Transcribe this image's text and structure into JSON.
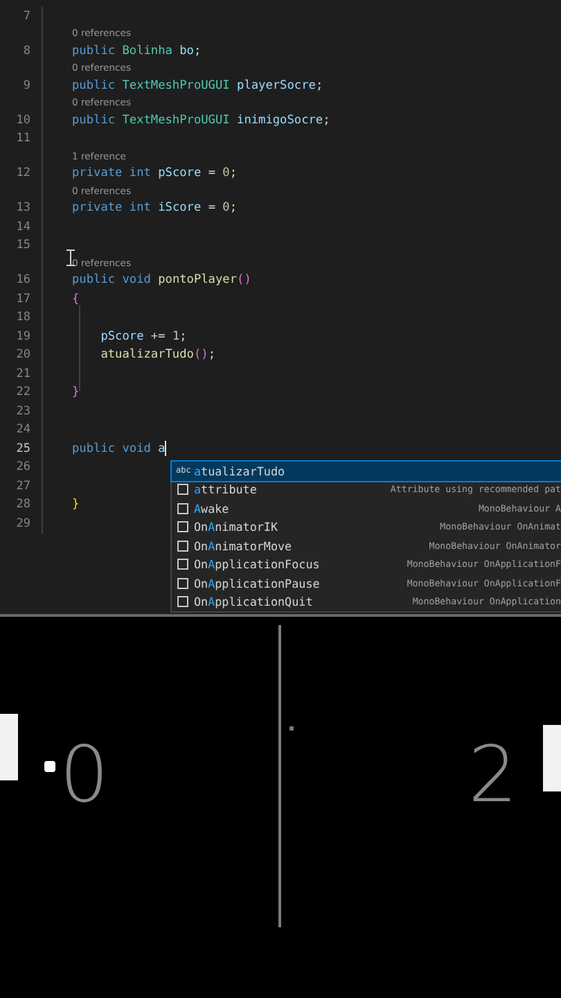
{
  "editor": {
    "lines": [
      {
        "kind": "code",
        "number": "7",
        "current": false
      },
      {
        "kind": "codelens",
        "text": "0 references"
      },
      {
        "kind": "code",
        "number": "8",
        "current": false,
        "tokens": [
          {
            "kind": "keyword",
            "text": "public "
          },
          {
            "kind": "type",
            "text": "Bolinha "
          },
          {
            "kind": "ident",
            "text": "bo"
          },
          {
            "kind": "punct",
            "text": ";"
          }
        ]
      },
      {
        "kind": "codelens",
        "text": "0 references"
      },
      {
        "kind": "code",
        "number": "9",
        "current": false,
        "tokens": [
          {
            "kind": "keyword",
            "text": "public "
          },
          {
            "kind": "type",
            "text": "TextMeshProUGUI "
          },
          {
            "kind": "ident",
            "text": "playerSocre"
          },
          {
            "kind": "punct",
            "text": ";"
          }
        ]
      },
      {
        "kind": "codelens",
        "text": "0 references"
      },
      {
        "kind": "code",
        "number": "10",
        "current": false,
        "tokens": [
          {
            "kind": "keyword",
            "text": "public "
          },
          {
            "kind": "type",
            "text": "TextMeshProUGUI "
          },
          {
            "kind": "ident",
            "text": "inimigoSocre"
          },
          {
            "kind": "punct",
            "text": ";"
          }
        ]
      },
      {
        "kind": "code",
        "number": "11",
        "current": false
      },
      {
        "kind": "codelens",
        "text": "1 reference"
      },
      {
        "kind": "code",
        "number": "12",
        "current": false,
        "tokens": [
          {
            "kind": "keyword",
            "text": "private int "
          },
          {
            "kind": "ident",
            "text": "pScore "
          },
          {
            "kind": "punct",
            "text": "= "
          },
          {
            "kind": "number",
            "text": "0"
          },
          {
            "kind": "punct",
            "text": ";"
          }
        ]
      },
      {
        "kind": "codelens",
        "text": "0 references"
      },
      {
        "kind": "code",
        "number": "13",
        "current": false,
        "tokens": [
          {
            "kind": "keyword",
            "text": "private int "
          },
          {
            "kind": "ident",
            "text": "iScore "
          },
          {
            "kind": "punct",
            "text": "= "
          },
          {
            "kind": "number",
            "text": "0"
          },
          {
            "kind": "punct",
            "text": ";"
          }
        ]
      },
      {
        "kind": "code",
        "number": "14",
        "current": false
      },
      {
        "kind": "code",
        "number": "15",
        "current": false
      },
      {
        "kind": "codelens",
        "text": "0 references"
      },
      {
        "kind": "code",
        "number": "16",
        "current": false,
        "tokens": [
          {
            "kind": "keyword",
            "text": "public void "
          },
          {
            "kind": "method",
            "text": "pontoPlayer"
          },
          {
            "kind": "paren",
            "text": "()"
          }
        ]
      },
      {
        "kind": "code",
        "number": "17",
        "current": false,
        "tokens": [
          {
            "kind": "brace",
            "text": "{"
          }
        ]
      },
      {
        "kind": "code",
        "number": "18",
        "current": false
      },
      {
        "kind": "code",
        "number": "19",
        "current": false,
        "tokens": [
          {
            "kind": "ident",
            "text": "    pScore "
          },
          {
            "kind": "punct",
            "text": "+= "
          },
          {
            "kind": "number",
            "text": "1"
          },
          {
            "kind": "punct",
            "text": ";"
          }
        ]
      },
      {
        "kind": "code",
        "number": "20",
        "current": false,
        "tokens": [
          {
            "kind": "method",
            "text": "    atualizarTudo"
          },
          {
            "kind": "paren",
            "text": "()"
          },
          {
            "kind": "punct",
            "text": ";"
          }
        ]
      },
      {
        "kind": "code",
        "number": "21",
        "current": false
      },
      {
        "kind": "code",
        "number": "22",
        "current": false,
        "tokens": [
          {
            "kind": "brace",
            "text": "}"
          }
        ]
      },
      {
        "kind": "code",
        "number": "23",
        "current": false
      },
      {
        "kind": "code",
        "number": "24",
        "current": false
      },
      {
        "kind": "code",
        "number": "25",
        "current": true,
        "tokens": [
          {
            "kind": "keyword",
            "text": "public void "
          },
          {
            "kind": "ident",
            "text": "a"
          }
        ]
      },
      {
        "kind": "code",
        "number": "26",
        "current": false
      },
      {
        "kind": "code",
        "number": "27",
        "current": false
      },
      {
        "kind": "code",
        "number": "28",
        "current": false,
        "tokens": [
          {
            "kind": "outerbrace",
            "text": "}"
          }
        ]
      },
      {
        "kind": "code",
        "number": "29",
        "current": false
      }
    ],
    "suggestions": [
      {
        "kind": "text",
        "icon_text": "abc",
        "selected": true,
        "match": "a",
        "after": "tualizarTudo"
      },
      {
        "kind": "method",
        "selected": false,
        "match": "a",
        "after": "ttribute",
        "detail": "Attribute using recommended pat"
      },
      {
        "kind": "method",
        "selected": false,
        "match": "A",
        "after": "wake",
        "detail": "MonoBehaviour A"
      },
      {
        "kind": "method",
        "selected": false,
        "before": "On",
        "match": "A",
        "after": "nimatorIK",
        "detail": "MonoBehaviour OnAnimat"
      },
      {
        "kind": "method",
        "selected": false,
        "before": "On",
        "match": "A",
        "after": "nimatorMove",
        "detail": "MonoBehaviour OnAnimator"
      },
      {
        "kind": "method",
        "selected": false,
        "before": "On",
        "match": "A",
        "after": "pplicationFocus",
        "detail": "MonoBehaviour OnApplicationF"
      },
      {
        "kind": "method",
        "selected": false,
        "before": "On",
        "match": "A",
        "after": "pplicationPause",
        "detail": "MonoBehaviour OnApplicationF"
      },
      {
        "kind": "method",
        "selected": false,
        "before": "On",
        "match": "A",
        "after": "pplicationQuit",
        "detail": "MonoBehaviour OnApplication"
      }
    ]
  },
  "game": {
    "scores": [
      {
        "text": "0"
      },
      {
        "text": "2"
      }
    ]
  }
}
